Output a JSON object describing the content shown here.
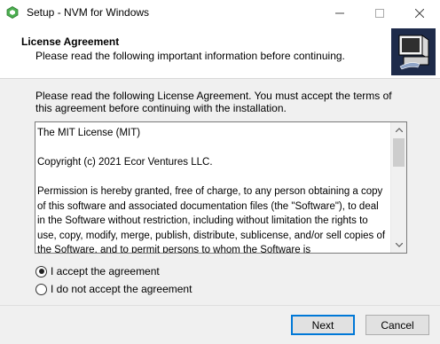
{
  "window": {
    "title": "Setup - NVM for Windows",
    "minimize_glyph": "—",
    "maximize_glyph": "☐",
    "close_glyph": "✕"
  },
  "header": {
    "title": "License Agreement",
    "subtitle": "Please read the following important information before continuing."
  },
  "intro_text": "Please read the following License Agreement. You must accept the terms of this agreement before continuing with the installation.",
  "license_text": "The MIT License (MIT)\n\nCopyright (c) 2021 Ecor Ventures LLC.\n\nPermission is hereby granted, free of charge, to any person obtaining a copy of this software and associated documentation files (the \"Software\"), to deal in the Software without restriction, including without limitation the rights to use, copy, modify, merge, publish, distribute, sublicense, and/or sell copies of the Software, and to permit persons to whom the Software is",
  "radios": {
    "accept_label": "I accept the agreement",
    "reject_label": "I do not accept the agreement",
    "selected": "accept"
  },
  "buttons": {
    "next": "Next",
    "cancel": "Cancel"
  },
  "icons": {
    "app": "nvm-app-icon",
    "header_logo": "installer-computer-icon",
    "scroll_up": "scroll-up-arrow-icon",
    "scroll_down": "scroll-down-arrow-icon"
  },
  "colors": {
    "default_button_border": "#0078d7",
    "logo_background": "#1e2b4a"
  }
}
